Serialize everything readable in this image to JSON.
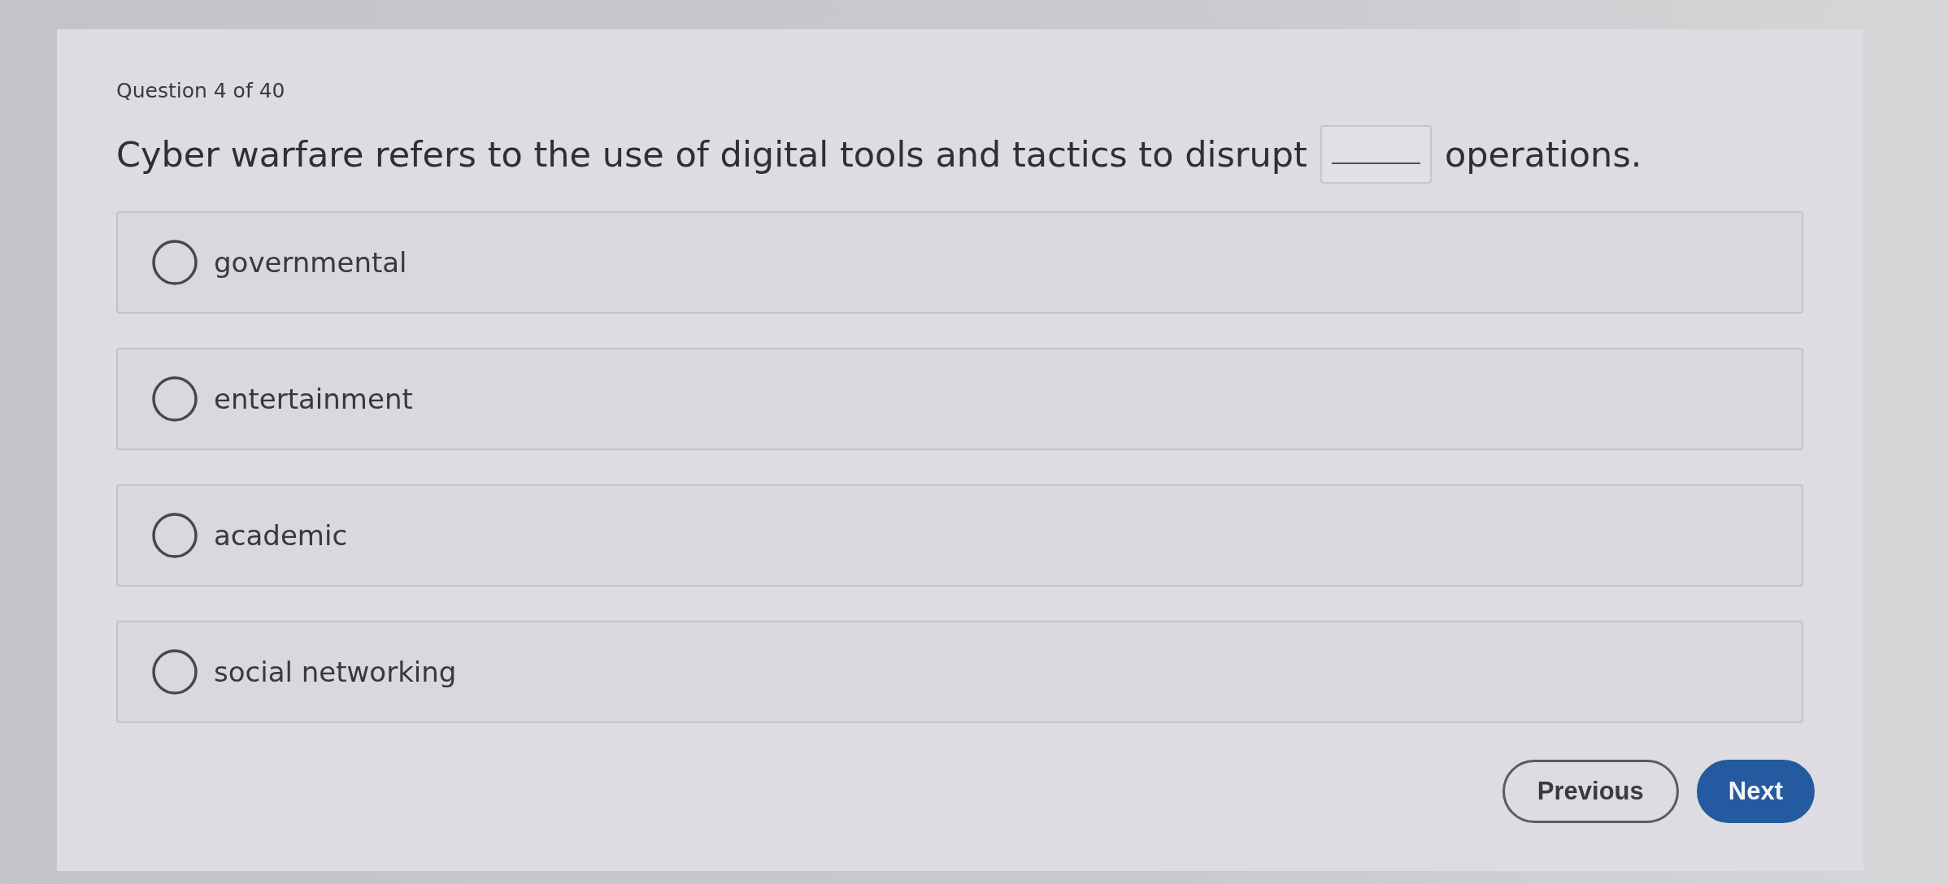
{
  "question_counter": "Question 4 of 40",
  "question": {
    "parts": [
      {
        "kind": "text",
        "text": "Cyber warfare refers to the use of digital tools and tactics to disrupt"
      },
      {
        "kind": "blank"
      },
      {
        "kind": "text",
        "text": "operations."
      }
    ]
  },
  "options": [
    {
      "label": "governmental",
      "selected": false
    },
    {
      "label": "entertainment",
      "selected": false
    },
    {
      "label": "academic",
      "selected": false
    },
    {
      "label": "social networking",
      "selected": false
    }
  ],
  "buttons": [
    {
      "label": "Previous",
      "kind": "secondary"
    },
    {
      "label": "Next",
      "kind": "primary"
    }
  ]
}
